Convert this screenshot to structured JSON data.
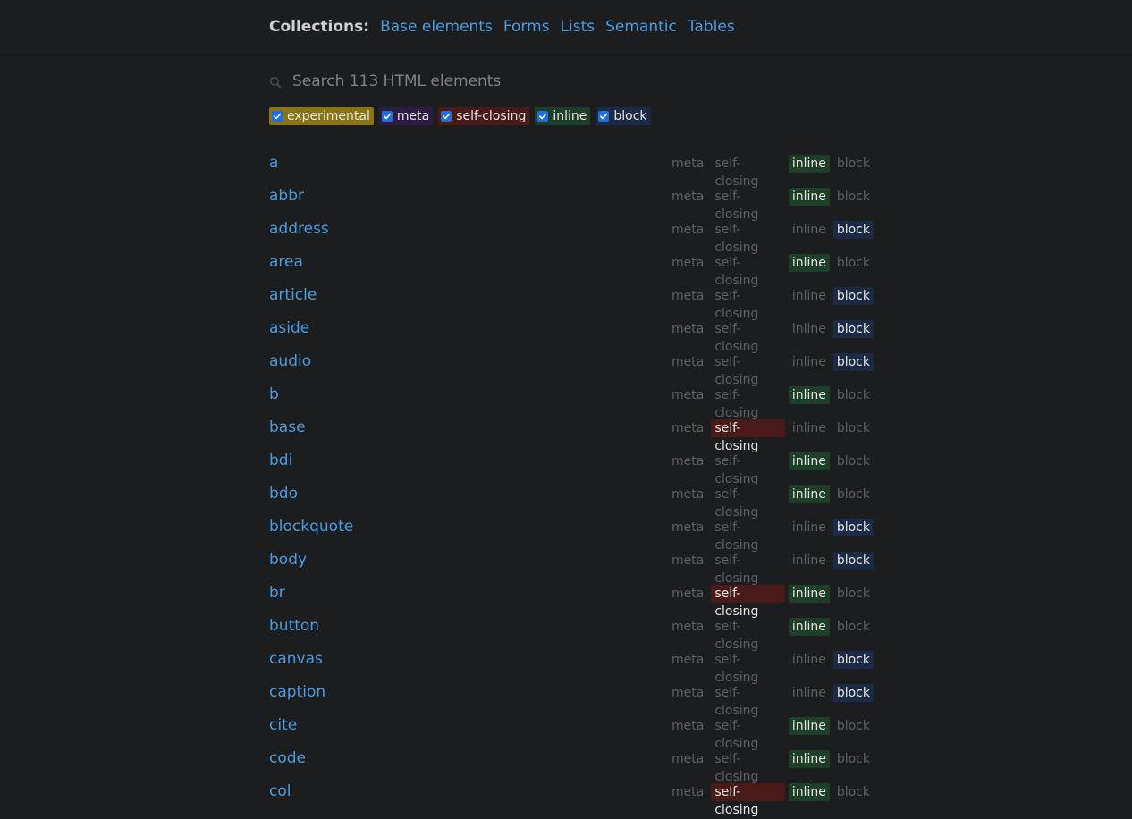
{
  "header": {
    "collections_label": "Collections:",
    "links": [
      "Base elements",
      "Forms",
      "Lists",
      "Semantic",
      "Tables"
    ]
  },
  "search": {
    "placeholder": "Search 113 HTML elements",
    "icon": "search-icon"
  },
  "filters": [
    {
      "label": "experimental",
      "checked": true,
      "color": "#8a7312"
    },
    {
      "label": "meta",
      "checked": true,
      "color": "#2e1b45"
    },
    {
      "label": "self-closing",
      "checked": true,
      "color": "#4a1a18"
    },
    {
      "label": "inline",
      "checked": true,
      "color": "#1e3f27"
    },
    {
      "label": "block",
      "checked": true,
      "color": "#1c2b45"
    }
  ],
  "tag_labels": [
    "meta",
    "self-closing",
    "inline",
    "block"
  ],
  "tag_colors": {
    "meta": "#2e1b45",
    "self-closing": "#4a1a18",
    "inline": "#1e3f27",
    "block": "#1c2b45"
  },
  "elements": [
    {
      "name": "a",
      "active": [
        "inline"
      ]
    },
    {
      "name": "abbr",
      "active": [
        "inline"
      ]
    },
    {
      "name": "address",
      "active": [
        "block"
      ]
    },
    {
      "name": "area",
      "active": [
        "inline"
      ]
    },
    {
      "name": "article",
      "active": [
        "block"
      ]
    },
    {
      "name": "aside",
      "active": [
        "block"
      ]
    },
    {
      "name": "audio",
      "active": [
        "block"
      ]
    },
    {
      "name": "b",
      "active": [
        "inline"
      ]
    },
    {
      "name": "base",
      "active": [
        "self-closing"
      ]
    },
    {
      "name": "bdi",
      "active": [
        "inline"
      ]
    },
    {
      "name": "bdo",
      "active": [
        "inline"
      ]
    },
    {
      "name": "blockquote",
      "active": [
        "block"
      ]
    },
    {
      "name": "body",
      "active": [
        "block"
      ]
    },
    {
      "name": "br",
      "active": [
        "self-closing",
        "inline"
      ]
    },
    {
      "name": "button",
      "active": [
        "inline"
      ]
    },
    {
      "name": "canvas",
      "active": [
        "block"
      ]
    },
    {
      "name": "caption",
      "active": [
        "block"
      ]
    },
    {
      "name": "cite",
      "active": [
        "inline"
      ]
    },
    {
      "name": "code",
      "active": [
        "inline"
      ]
    },
    {
      "name": "col",
      "active": [
        "self-closing",
        "inline"
      ]
    }
  ]
}
